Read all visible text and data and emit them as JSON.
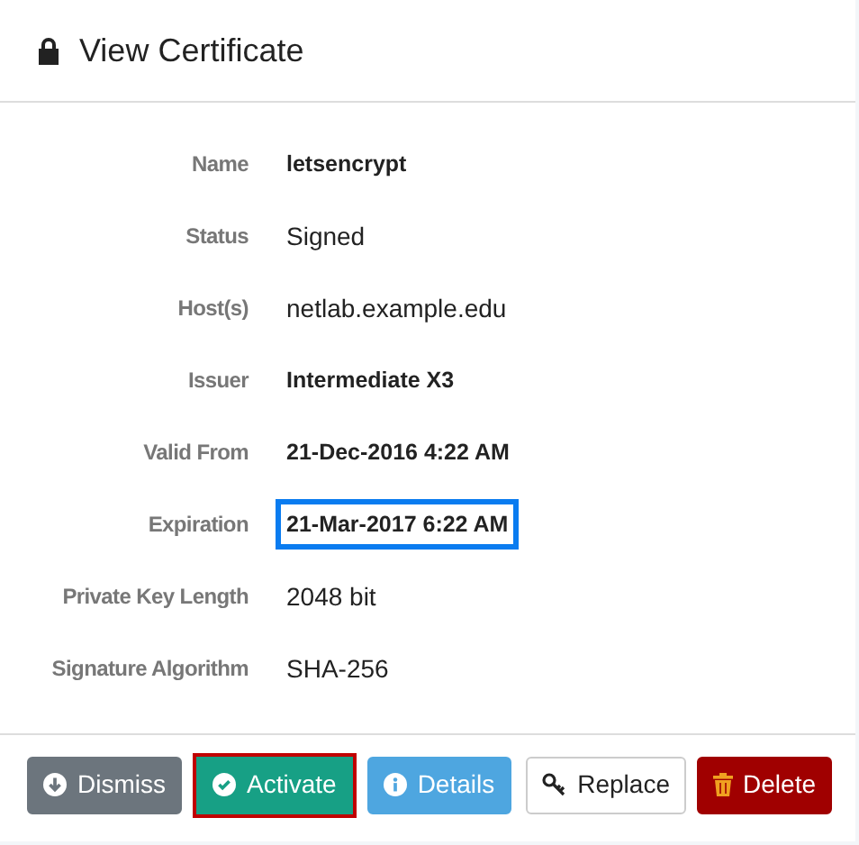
{
  "title": "View Certificate",
  "fields": [
    {
      "label": "Name",
      "value": "letsencrypt",
      "bold": true,
      "highlighted": false
    },
    {
      "label": "Status",
      "value": "Signed",
      "bold": false,
      "highlighted": false
    },
    {
      "label": "Host(s)",
      "value": "netlab.example.edu",
      "bold": false,
      "highlighted": false
    },
    {
      "label": "Issuer",
      "value": "Intermediate X3",
      "bold": true,
      "highlighted": false
    },
    {
      "label": "Valid From",
      "value": "21-Dec-2016 4:22 AM",
      "bold": true,
      "highlighted": false
    },
    {
      "label": "Expiration",
      "value": "21-Mar-2017 6:22 AM",
      "bold": true,
      "highlighted": true
    },
    {
      "label": "Private Key Length",
      "value": "2048 bit",
      "bold": false,
      "highlighted": false
    },
    {
      "label": "Signature Algorithm",
      "value": "SHA-256",
      "bold": false,
      "highlighted": false
    }
  ],
  "buttons": [
    {
      "label": "Dismiss",
      "kind": "dismiss",
      "highlighted": false
    },
    {
      "label": "Activate",
      "kind": "activate",
      "highlighted": true
    },
    {
      "label": "Details",
      "kind": "details",
      "highlighted": false
    },
    {
      "label": "Replace",
      "kind": "replace",
      "highlighted": false
    },
    {
      "label": "Delete",
      "kind": "delete",
      "highlighted": false
    }
  ]
}
